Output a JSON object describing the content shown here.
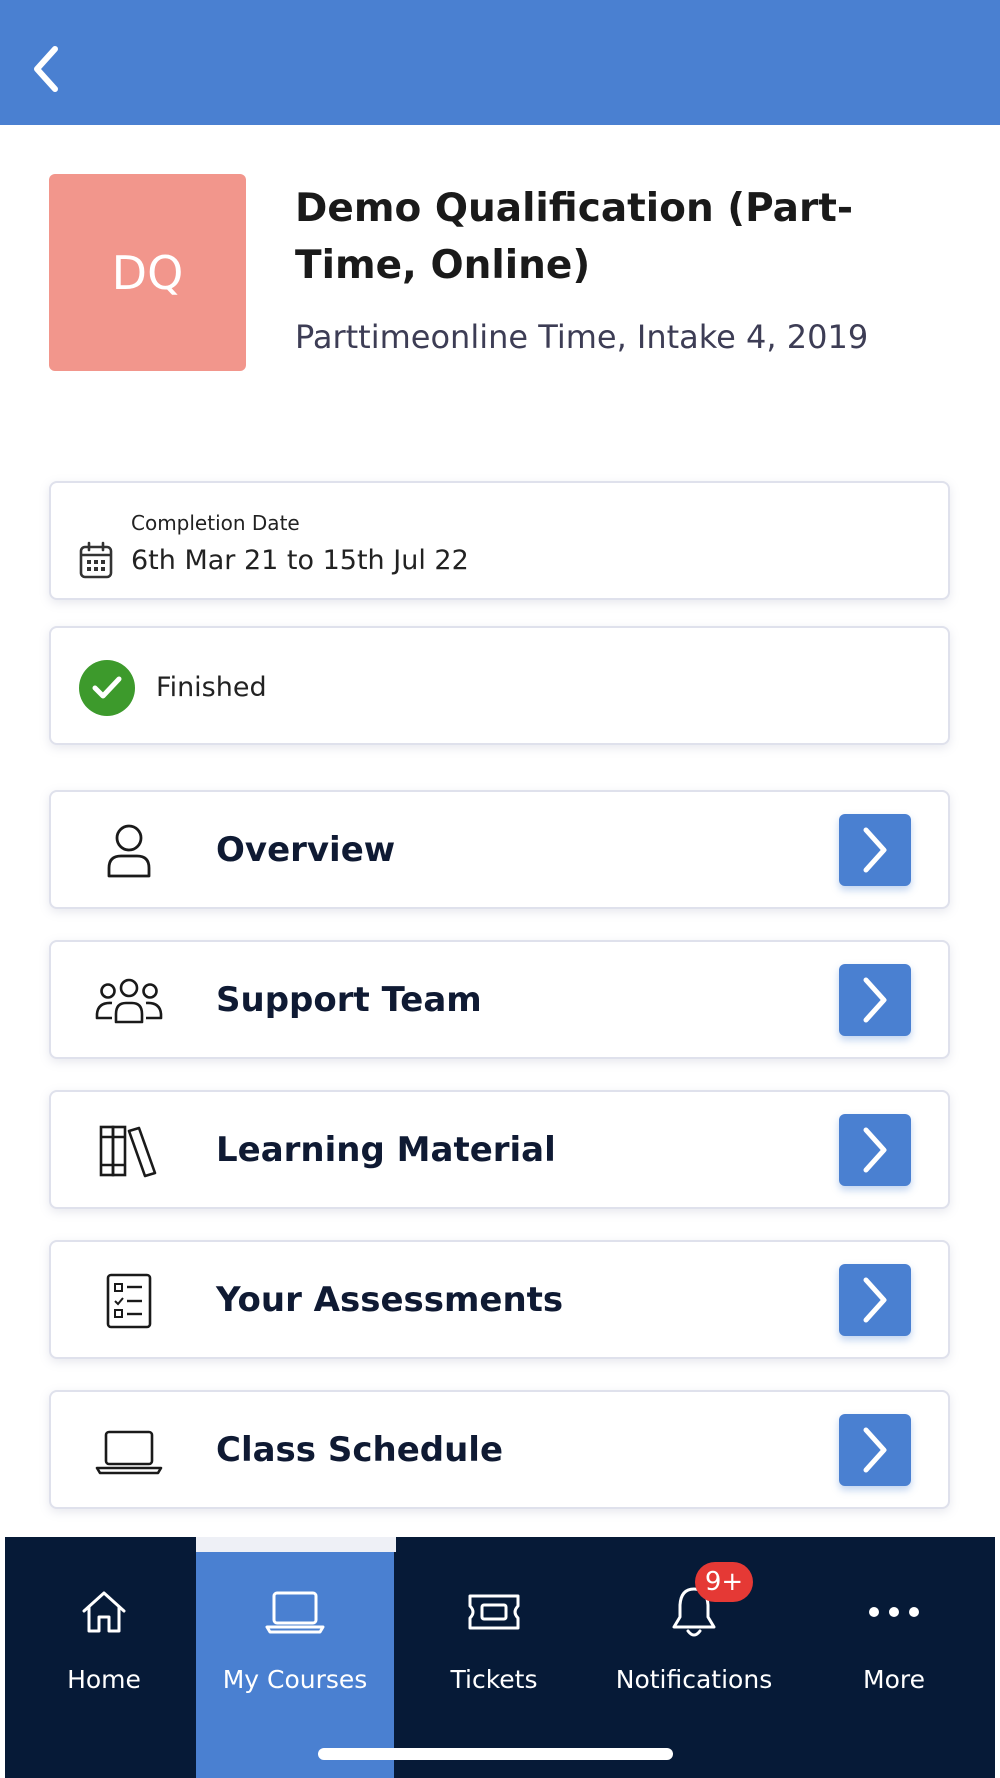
{
  "header": {
    "back_icon": "chevron-left-icon"
  },
  "course": {
    "initials": "DQ",
    "title": "Demo Qualification (Part-Time, Online)",
    "subtitle": "Parttimeonline Time, Intake 4, 2019",
    "thumb_color": "#f2968c"
  },
  "completion": {
    "label": "Completion Date",
    "value": "6th Mar 21 to 15th Jul 22",
    "icon": "calendar-icon"
  },
  "status": {
    "label": "Finished",
    "icon": "check-circle-icon",
    "color": "#3d9a2c"
  },
  "menu": [
    {
      "label": "Overview",
      "icon": "user-icon"
    },
    {
      "label": "Support Team",
      "icon": "team-icon"
    },
    {
      "label": "Learning Material",
      "icon": "books-icon"
    },
    {
      "label": "Your Assessments",
      "icon": "checklist-icon"
    },
    {
      "label": "Class Schedule",
      "icon": "laptop-icon"
    }
  ],
  "tabs": [
    {
      "label": "Home",
      "icon": "home-icon",
      "active": false
    },
    {
      "label": "My Courses",
      "icon": "laptop-icon",
      "active": true
    },
    {
      "label": "Tickets",
      "icon": "ticket-icon",
      "active": false
    },
    {
      "label": "Notifications",
      "icon": "bell-icon",
      "active": false,
      "badge": "9+"
    },
    {
      "label": "More",
      "icon": "more-dots-icon",
      "active": false
    }
  ],
  "colors": {
    "accent": "#4a80d1",
    "tabbar": "#061a37",
    "badge": "#e53935"
  }
}
